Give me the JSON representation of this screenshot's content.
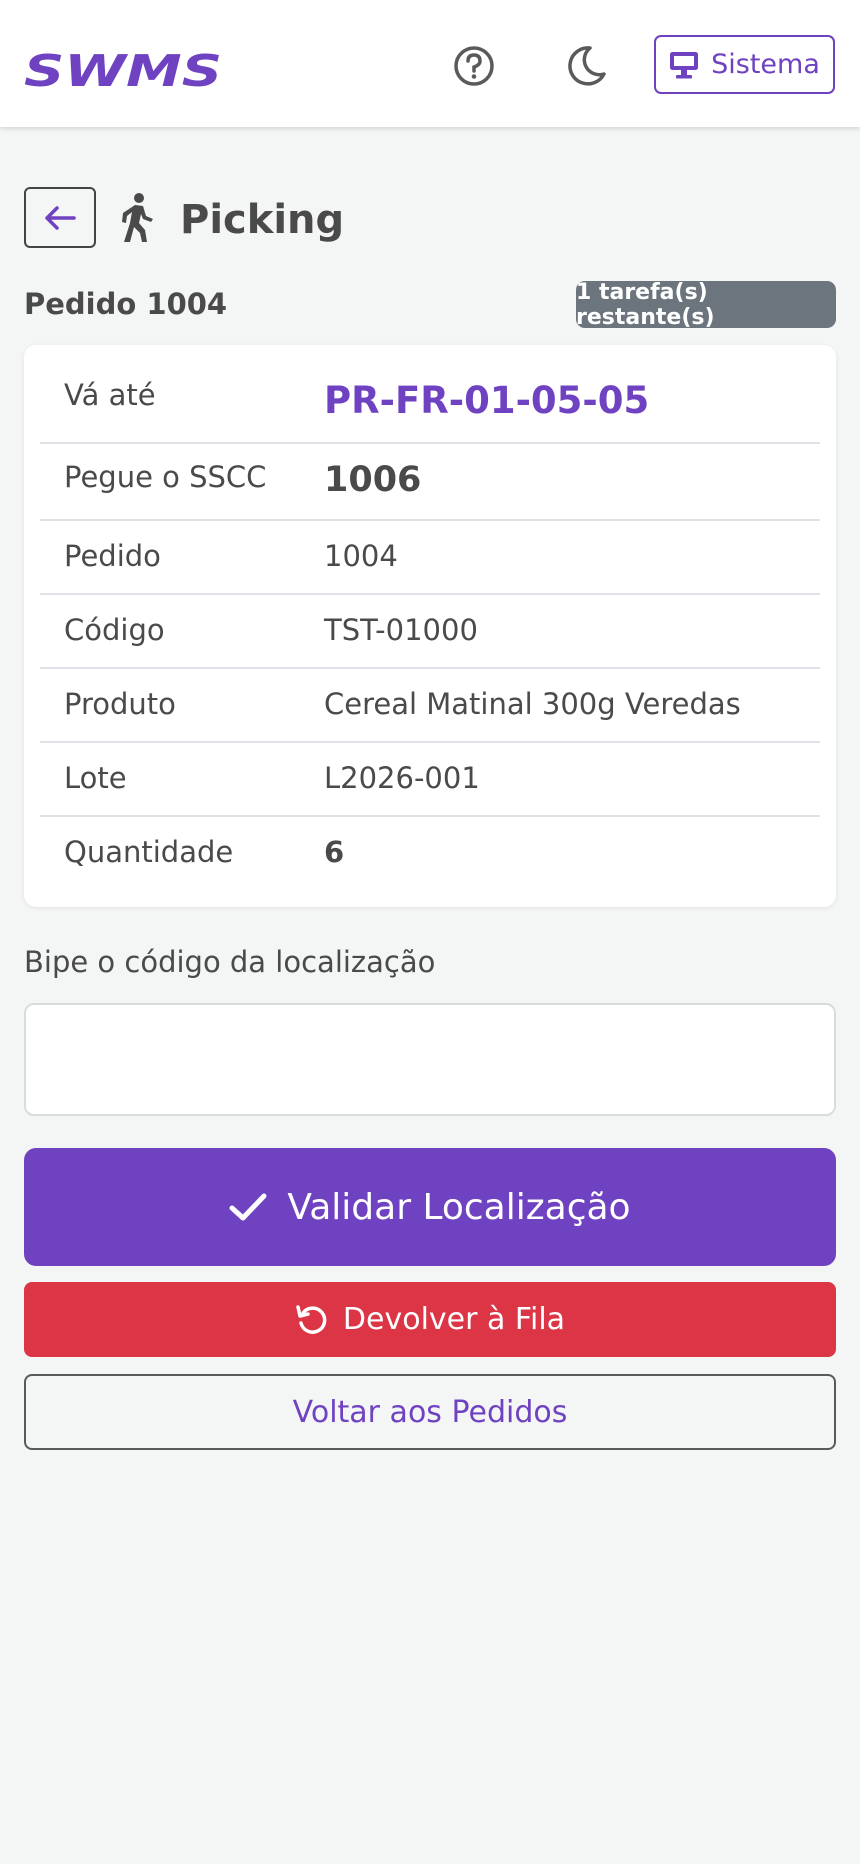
{
  "navbar": {
    "logo_text": "SWMS",
    "help_icon": "question-circle-icon",
    "theme_icon": "moon-icon",
    "system_button_label": "Sistema",
    "system_icon": "desktop-icon"
  },
  "header": {
    "back_icon": "arrow-left-icon",
    "page_icon": "walking-person-icon",
    "title": "Picking"
  },
  "order": {
    "label": "Pedido 1004",
    "remaining_badge": "1 tarefa(s) restante(s)"
  },
  "details": [
    {
      "label": "Vá até",
      "value": "PR-FR-01-05-05"
    },
    {
      "label": "Pegue o SSCC",
      "value": "1006"
    },
    {
      "label": "Pedido",
      "value": "1004"
    },
    {
      "label": "Código",
      "value": "TST-01000"
    },
    {
      "label": "Produto",
      "value": "Cereal Matinal 300g Veredas"
    },
    {
      "label": "Lote",
      "value": "L2026-001"
    },
    {
      "label": "Quantidade",
      "value": "6"
    }
  ],
  "scan": {
    "label": "Bipe o código da localização",
    "value": "",
    "placeholder": ""
  },
  "actions": {
    "validate_label": "Validar Localização",
    "validate_icon": "check-icon",
    "return_label": "Devolver à Fila",
    "return_icon": "undo-icon",
    "back_orders_label": "Voltar aos Pedidos"
  },
  "colors": {
    "primary": "#6f42c1",
    "danger": "#dc3545",
    "secondary": "#6c757d"
  }
}
